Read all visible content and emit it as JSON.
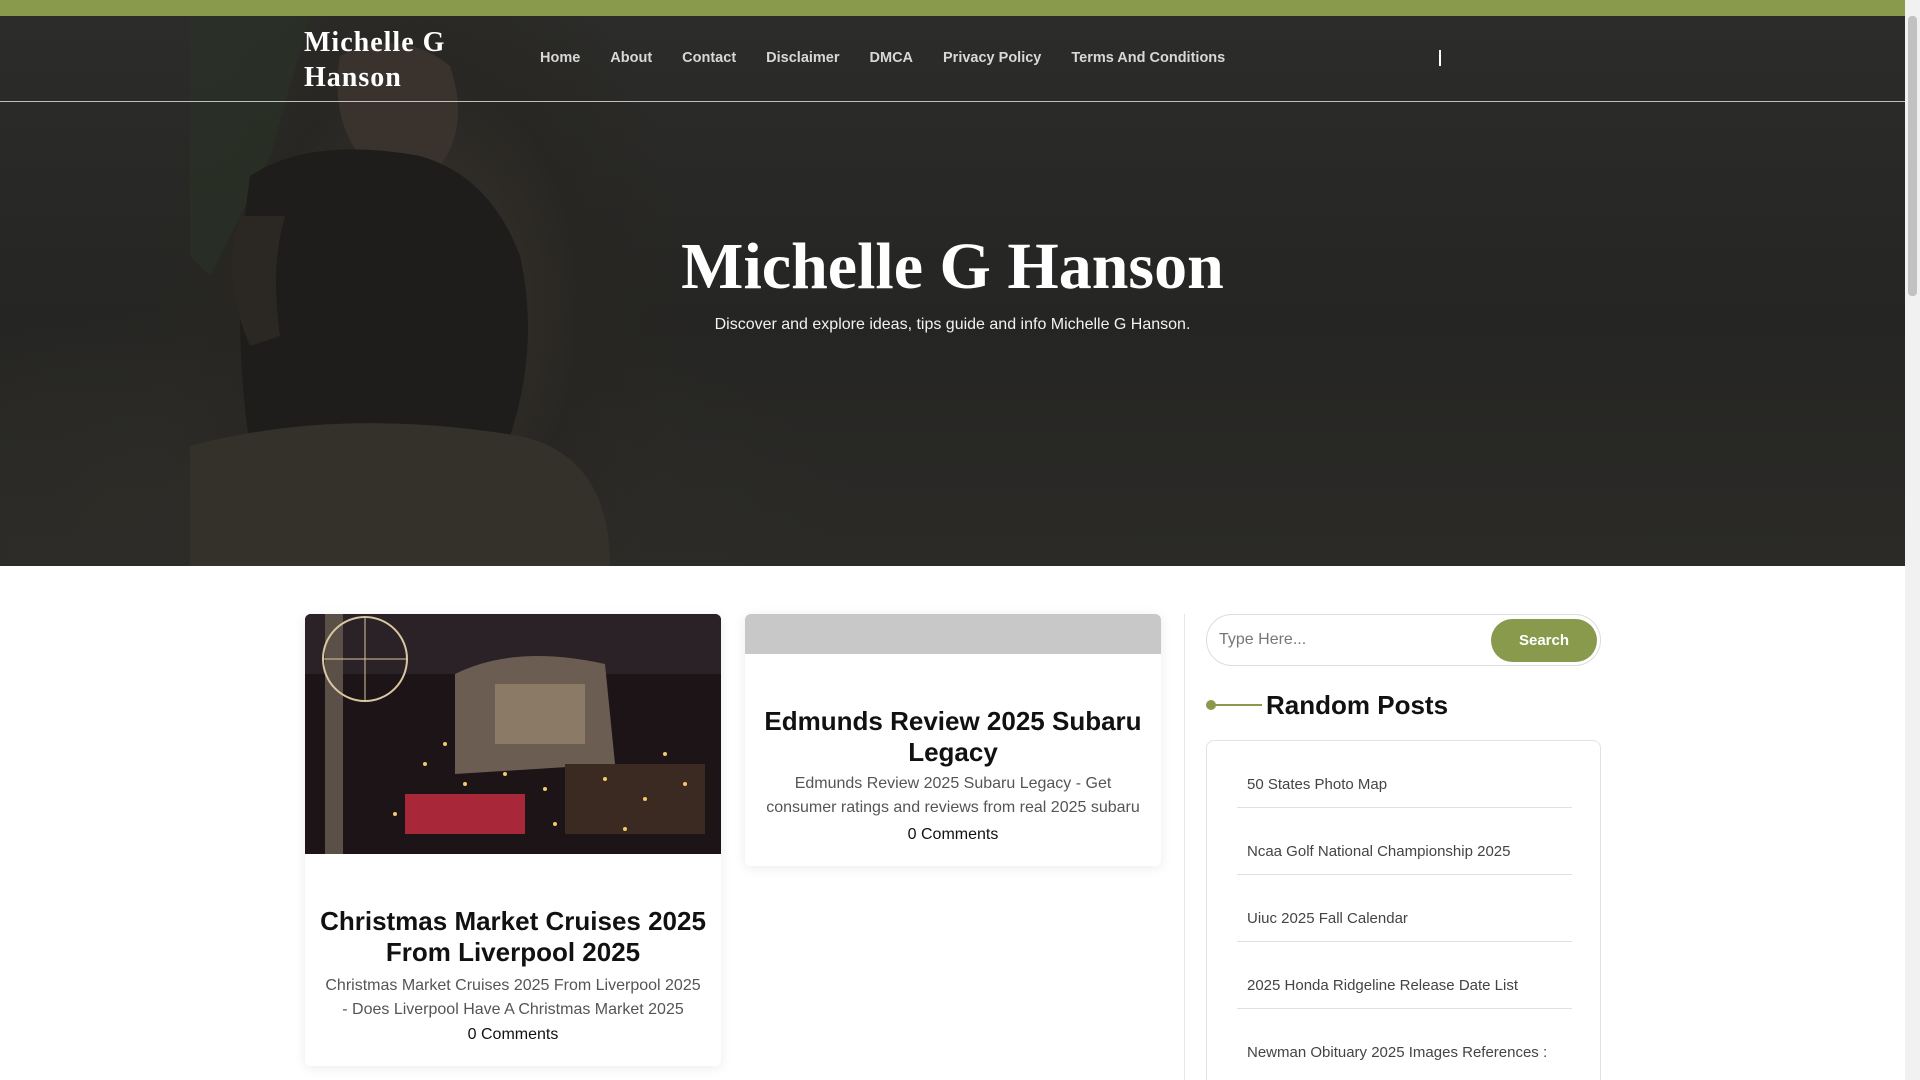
{
  "site": {
    "logo": "Michelle G Hanson",
    "hero_title": "Michelle G Hanson",
    "hero_subtitle": "Discover and explore ideas, tips guide and info Michelle G Hanson."
  },
  "nav": {
    "items": [
      {
        "label": "Home"
      },
      {
        "label": "About"
      },
      {
        "label": "Contact"
      },
      {
        "label": "Disclaimer"
      },
      {
        "label": "DMCA"
      },
      {
        "label": "Privacy Policy"
      },
      {
        "label": "Terms And Conditions"
      }
    ]
  },
  "posts": [
    {
      "title": "Christmas Market Cruises 2025 From Liverpool 2025",
      "excerpt": "Christmas Market Cruises 2025 From Liverpool 2025 - Does Liverpool Have A Christmas Market 2025",
      "comments": "0 Comments"
    },
    {
      "title": "Edmunds Review 2025 Subaru Legacy",
      "excerpt": "Edmunds Review 2025 Subaru Legacy - Get consumer ratings and reviews from real 2025 subaru",
      "comments": "0 Comments"
    }
  ],
  "sidebar": {
    "search_placeholder": "Type Here...",
    "search_button": "Search",
    "random_posts_title": "Random Posts",
    "random_posts": [
      {
        "label": "50 States Photo Map"
      },
      {
        "label": "Ncaa Golf National Championship 2025"
      },
      {
        "label": "Uiuc 2025 Fall Calendar"
      },
      {
        "label": "2025 Honda Ridgeline Release Date List"
      },
      {
        "label": "Newman Obituary 2025 Images References :"
      }
    ]
  },
  "colors": {
    "accent": "#8a9a4d",
    "hero_overlay": "#2a2a28"
  }
}
